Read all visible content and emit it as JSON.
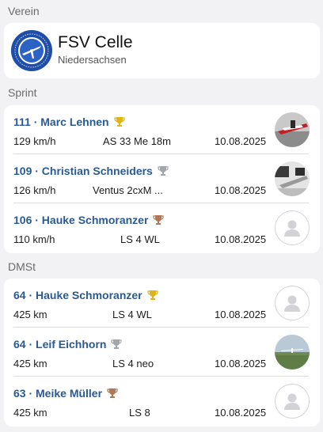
{
  "club_section": {
    "label": "Verein",
    "name": "FSV Celle",
    "region": "Niedersachsen"
  },
  "sprint": {
    "label": "Sprint",
    "rows": [
      {
        "title": "111 · Marc Lehnen",
        "trophy": "gold-trophy-icon",
        "value": "129 km/h",
        "aircraft": "AS 33 Me 18m",
        "date": "10.08.2025",
        "avatar": "photo-glider-avatar"
      },
      {
        "title": "109 · Christian Schneiders",
        "trophy": "silver-trophy-icon",
        "value": "126 km/h",
        "aircraft": "Ventus 2cxM ...",
        "date": "10.08.2025",
        "avatar": "photo-glider-avatar"
      },
      {
        "title": "106 · Hauke Schmoranzer",
        "trophy": "bronze-trophy-icon",
        "value": "110 km/h",
        "aircraft": "LS 4 WL",
        "date": "10.08.2025",
        "avatar": "placeholder-avatar"
      }
    ]
  },
  "dmst": {
    "label": "DMSt",
    "rows": [
      {
        "title": "64 · Hauke Schmoranzer",
        "trophy": "gold-trophy-icon",
        "value": "425 km",
        "aircraft": "LS 4 WL",
        "date": "10.08.2025",
        "avatar": "placeholder-avatar"
      },
      {
        "title": "64 · Leif Eichhorn",
        "trophy": "silver-trophy-icon",
        "value": "425 km",
        "aircraft": "LS 4 neo",
        "date": "10.08.2025",
        "avatar": "photo-landscape-avatar"
      },
      {
        "title": "63 · Meike Müller",
        "trophy": "bronze-trophy-icon",
        "value": "425 km",
        "aircraft": "LS 8",
        "date": "10.08.2025",
        "avatar": "placeholder-avatar"
      }
    ]
  },
  "colors": {
    "title": "#2a5a93",
    "gold": "#e0b515",
    "silver": "#a3a7ab",
    "bronze": "#b07856",
    "background": "#f2f2f4"
  }
}
